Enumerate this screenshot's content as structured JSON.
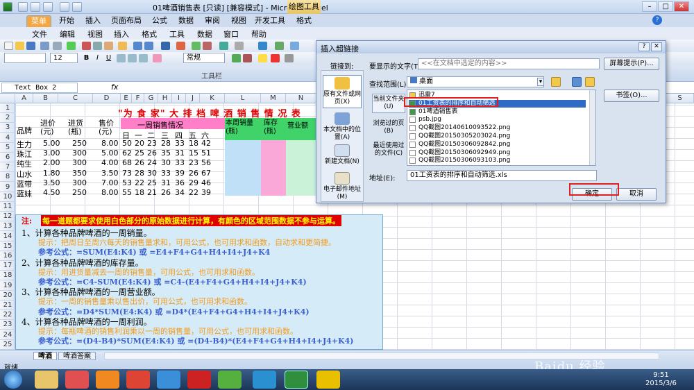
{
  "titlebar": {
    "title": "01啤酒销售表 [只读] [兼容模式] - Microsoft Excel",
    "context_tab": "绘图工具"
  },
  "tabs": [
    "菜单",
    "开始",
    "插入",
    "页面布局",
    "公式",
    "数据",
    "审阅",
    "视图",
    "开发工具",
    "格式"
  ],
  "menus": [
    "文件",
    "编辑",
    "视图",
    "插入",
    "格式",
    "工具",
    "数据",
    "窗口",
    "帮助"
  ],
  "toolbar": {
    "font_size": "12",
    "style_select": "常规",
    "section_label": "工具栏"
  },
  "formulabar": {
    "name_box": "Text Box 2",
    "fx": "fx"
  },
  "columns": [
    "A",
    "B",
    "C",
    "D",
    "E",
    "F",
    "G",
    "H",
    "I",
    "J",
    "K",
    "L",
    "M",
    "N",
    "O",
    "P",
    "Q",
    "R",
    "S"
  ],
  "rows": [
    "1",
    "2",
    "3",
    "4",
    "5",
    "6",
    "7",
    "8",
    "9",
    "10",
    "11",
    "12",
    "13",
    "14",
    "15",
    "16",
    "17",
    "18",
    "19",
    "20",
    "21",
    "22",
    "23",
    "24",
    "25"
  ],
  "sheet": {
    "title": "\"为 食 家\" 大 排 档 啤 酒 销 售 情 况 表",
    "h_brand": "品牌",
    "h_cost": "进价(元)",
    "h_stock_in": "进货(瓶)",
    "h_price": "售价(元)",
    "h_week": "一周销售情况",
    "h_days": [
      "日",
      "一",
      "二",
      "三",
      "四",
      "五",
      "六"
    ],
    "h_weekly": "本周销量(瓶)",
    "h_inv": "库存(瓶)",
    "h_rev": "营业额",
    "data": [
      [
        "生力",
        "5.00",
        "250",
        "8.00",
        "50",
        "20",
        "23",
        "28",
        "33",
        "18",
        "42"
      ],
      [
        "珠江",
        "3.00",
        "300",
        "5.00",
        "62",
        "25",
        "26",
        "35",
        "31",
        "15",
        "51"
      ],
      [
        "纯生",
        "2.00",
        "300",
        "4.00",
        "68",
        "26",
        "24",
        "30",
        "33",
        "23",
        "56"
      ],
      [
        "山水",
        "1.80",
        "350",
        "3.50",
        "73",
        "28",
        "30",
        "33",
        "39",
        "26",
        "67"
      ],
      [
        "蓝带",
        "3.50",
        "300",
        "7.00",
        "53",
        "22",
        "25",
        "31",
        "36",
        "29",
        "46"
      ],
      [
        "蓝妹",
        "4.50",
        "250",
        "8.00",
        "55",
        "18",
        "21",
        "26",
        "34",
        "22",
        "39"
      ]
    ]
  },
  "instructions": {
    "note_label": "注:",
    "note": "每一道题都要求使用白色部分的原始数据进行计算，有颜色的区域范围数据不参与运算。",
    "lines": [
      "1、计算各种品牌啤酒的一周销量。",
      "提示：把周日至周六每天的销售量求和，可用公式，也可用求和函数，自动求和更简捷。",
      "参考公式：=SUM(E4:K4)   或   =E4+F4+G4+H4+I4+J4+K4",
      "2、计算各种品牌啤酒的库存量。",
      "提示：用进货量减去一周的销售量，可用公式，也可用求和函数。",
      "参考公式：=C4-SUM(E4:K4)   或   =C4-(E4+F4+G4+H4+I4+J4+K4)",
      "3、计算各种品牌啤酒的一周营业额。",
      "提示：一周的销售量乘以售出价，可用公式，也可用求和函数。",
      "参考公式：=D4*SUM(E4:K4)   或   =D4*(E4+F4+G4+H4+I4+J4+K4)",
      "4、计算各种品牌啤酒的一周利润。",
      "提示：每瓶啤酒的销售利润乘以一周的销售量，可用公式，也可用求和函数。",
      "参考公式：=(D4-B4)*SUM(E4:K4)   或   =(D4-B4)*(E4+F4+G4+H4+I4+J4+K4)"
    ]
  },
  "dialog": {
    "title": "插入超链接",
    "link_to": "链接到:",
    "display_text_label": "要显示的文字(T):",
    "display_text_value": "<<在文档中选定的内容>>",
    "screen_tip": "屏幕提示(P)...",
    "lookin_label": "查找范围(L):",
    "lookin_value": "桌面",
    "bookmark": "书签(O)...",
    "link_items": [
      "原有文件或网页(X)",
      "本文档中的位置(A)",
      "新建文档(N)",
      "电子邮件地址(M)"
    ],
    "side_items": [
      "当前文件夹(U)",
      "浏览过的页(B)",
      "最近使用过的文件(C)"
    ],
    "files": [
      "迅雷7",
      "01工资表的排序和自动筛选",
      "01啤酒销售表",
      "psb.jpg",
      "QQ截图20140610093522.png",
      "QQ截图20150305203024.png",
      "QQ截图20150306092842.png",
      "QQ截图20150306092949.png",
      "QQ截图20150306093103.png"
    ],
    "address_label": "地址(E):",
    "address_value": "01工资表的排序和自动筛选.xls",
    "ok": "确定",
    "cancel": "取消"
  },
  "statusbar": {
    "ready": "就绪",
    "sheets": [
      "啤酒",
      "啤酒答案"
    ]
  },
  "taskbar": {
    "time": "9:51",
    "date": "2015/3/6"
  },
  "watermark": "Baidu 经验 jingyan.baidu.com"
}
